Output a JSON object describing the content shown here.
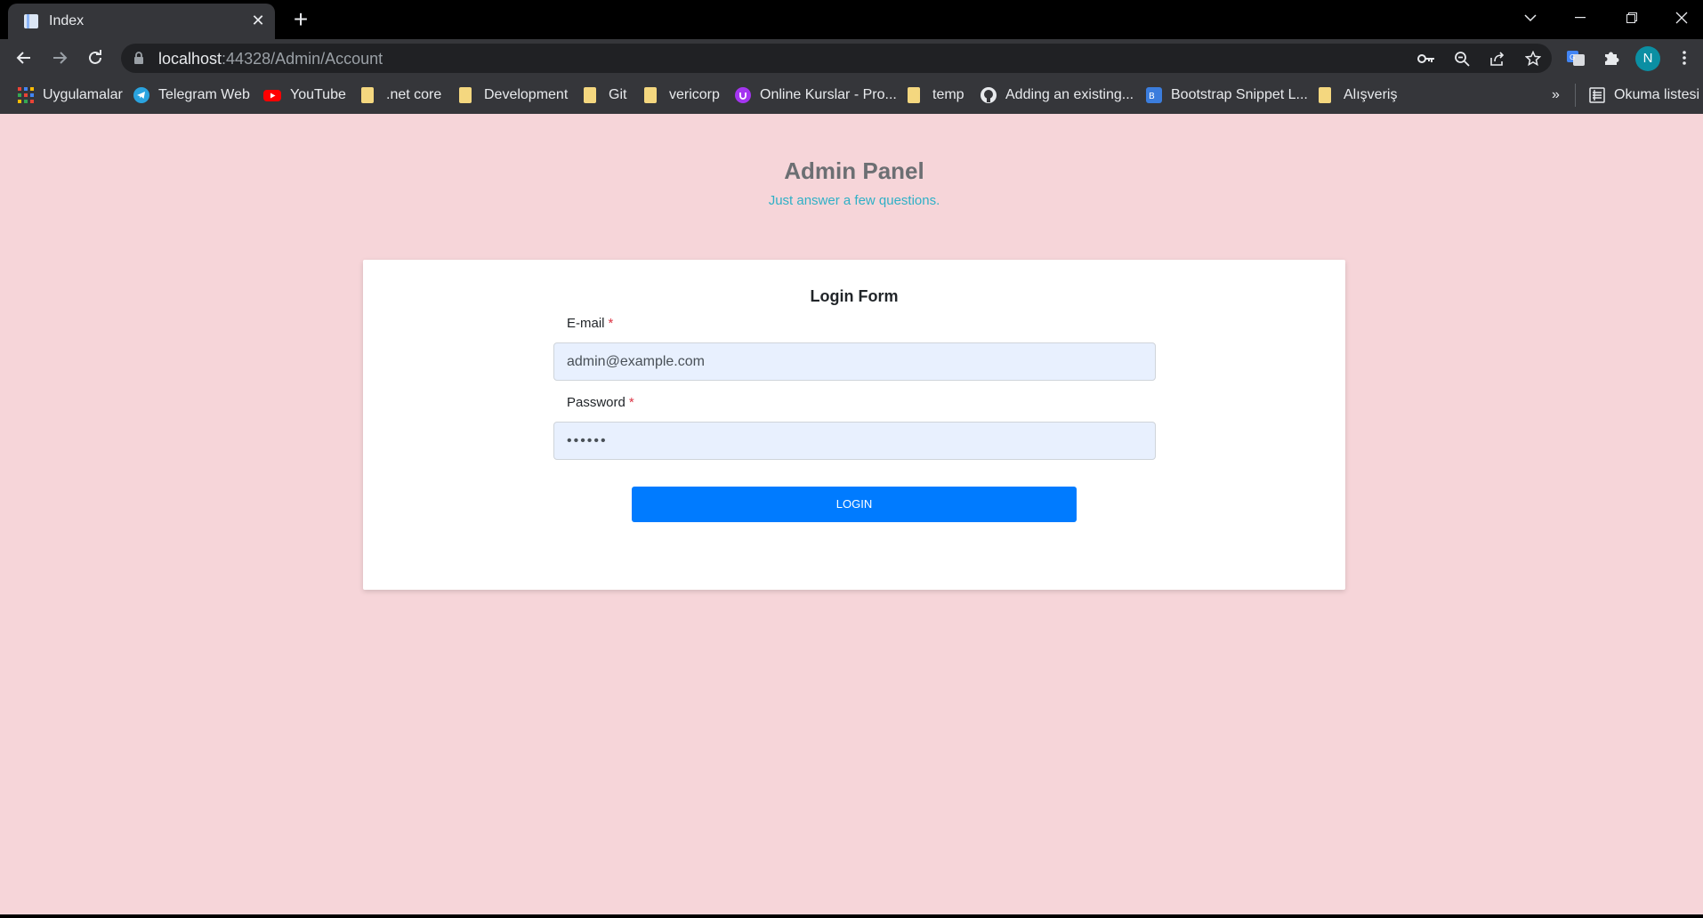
{
  "browser": {
    "tab": {
      "title": "Index",
      "close": "✕"
    },
    "new_tab": "+",
    "window_controls": [
      "chevron-down-icon",
      "minimize-icon",
      "restore-icon",
      "close-icon"
    ],
    "url": {
      "host": "localhost",
      "path": ":44328/Admin/Account"
    },
    "avatar_letter": "N",
    "bookmarks": [
      {
        "label": "Uygulamalar",
        "icon": "apps-grid-icon"
      },
      {
        "label": "Telegram Web",
        "icon": "telegram-icon"
      },
      {
        "label": "YouTube",
        "icon": "youtube-icon"
      },
      {
        "label": ".net core",
        "icon": "folder-icon"
      },
      {
        "label": "Development",
        "icon": "folder-icon"
      },
      {
        "label": "Git",
        "icon": "folder-icon"
      },
      {
        "label": "vericorp",
        "icon": "folder-icon"
      },
      {
        "label": "Online Kurslar - Pro...",
        "icon": "udemy-icon"
      },
      {
        "label": "temp",
        "icon": "folder-icon"
      },
      {
        "label": "Adding an existing...",
        "icon": "github-icon"
      },
      {
        "label": "Bootstrap Snippet L...",
        "icon": "bootstrap-icon"
      },
      {
        "label": "Alışveriş",
        "icon": "folder-icon"
      }
    ],
    "bookmarks_overflow": "»",
    "reading_list": "Okuma listesi"
  },
  "page": {
    "title": "Admin Panel",
    "subtitle": "Just answer a few questions.",
    "background": "#f6d5d9"
  },
  "login_form": {
    "title": "Login Form",
    "email_label": "E-mail",
    "email_value": "admin@example.com",
    "password_label": "Password",
    "password_value": "••••••",
    "required_marker": "*",
    "submit_label": "LOGIN",
    "accent": "#007bff"
  }
}
